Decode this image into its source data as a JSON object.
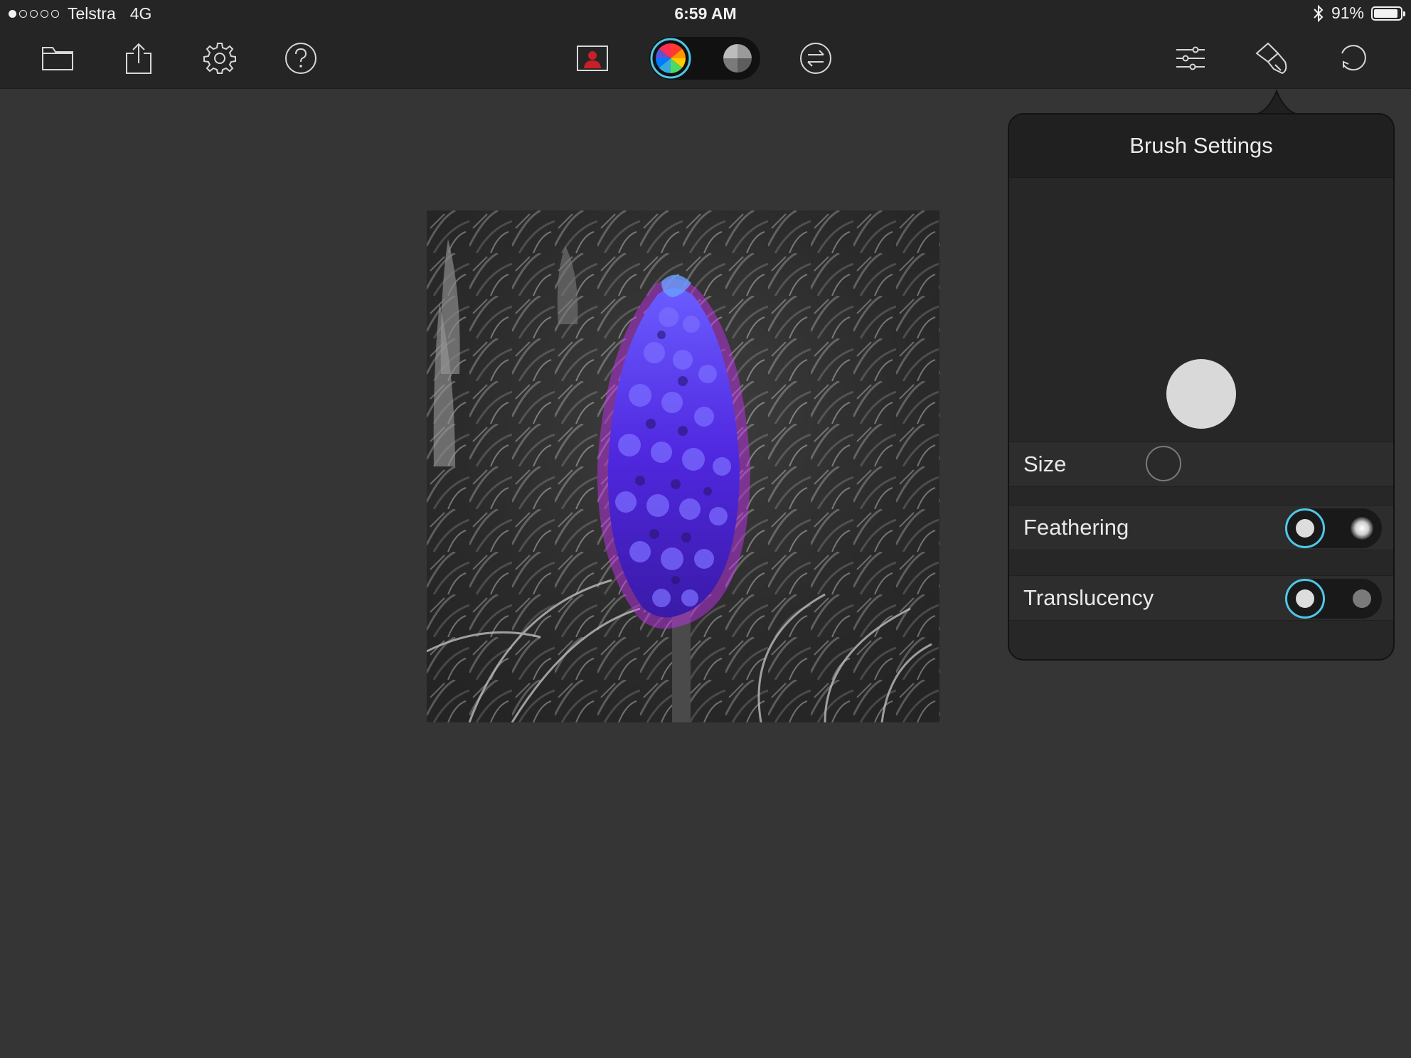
{
  "status_bar": {
    "carrier": "Telstra",
    "network": "4G",
    "time": "6:59 AM",
    "battery": "91%",
    "battery_level": 0.91,
    "signal_bars_filled": 1,
    "signal_bars_total": 5
  },
  "toolbar": {
    "left_icons": [
      "folder-icon",
      "share-icon",
      "gear-icon",
      "help-icon"
    ],
    "center_icons": [
      "portrait-icon",
      "color-wheel-icon",
      "grayscale-icon",
      "swap-icon"
    ],
    "right_icons": [
      "sliders-icon",
      "brush-icon",
      "undo-icon"
    ],
    "selected_mode": "color"
  },
  "brush_settings": {
    "title": "Brush Settings",
    "size_label": "Size",
    "feathering_label": "Feathering",
    "translucency_label": "Translucency",
    "feathering_selected": "hard",
    "translucency_selected": "opaque"
  },
  "colors": {
    "accent": "#4fc8e8",
    "background": "#353535",
    "toolbar": "#252525"
  }
}
